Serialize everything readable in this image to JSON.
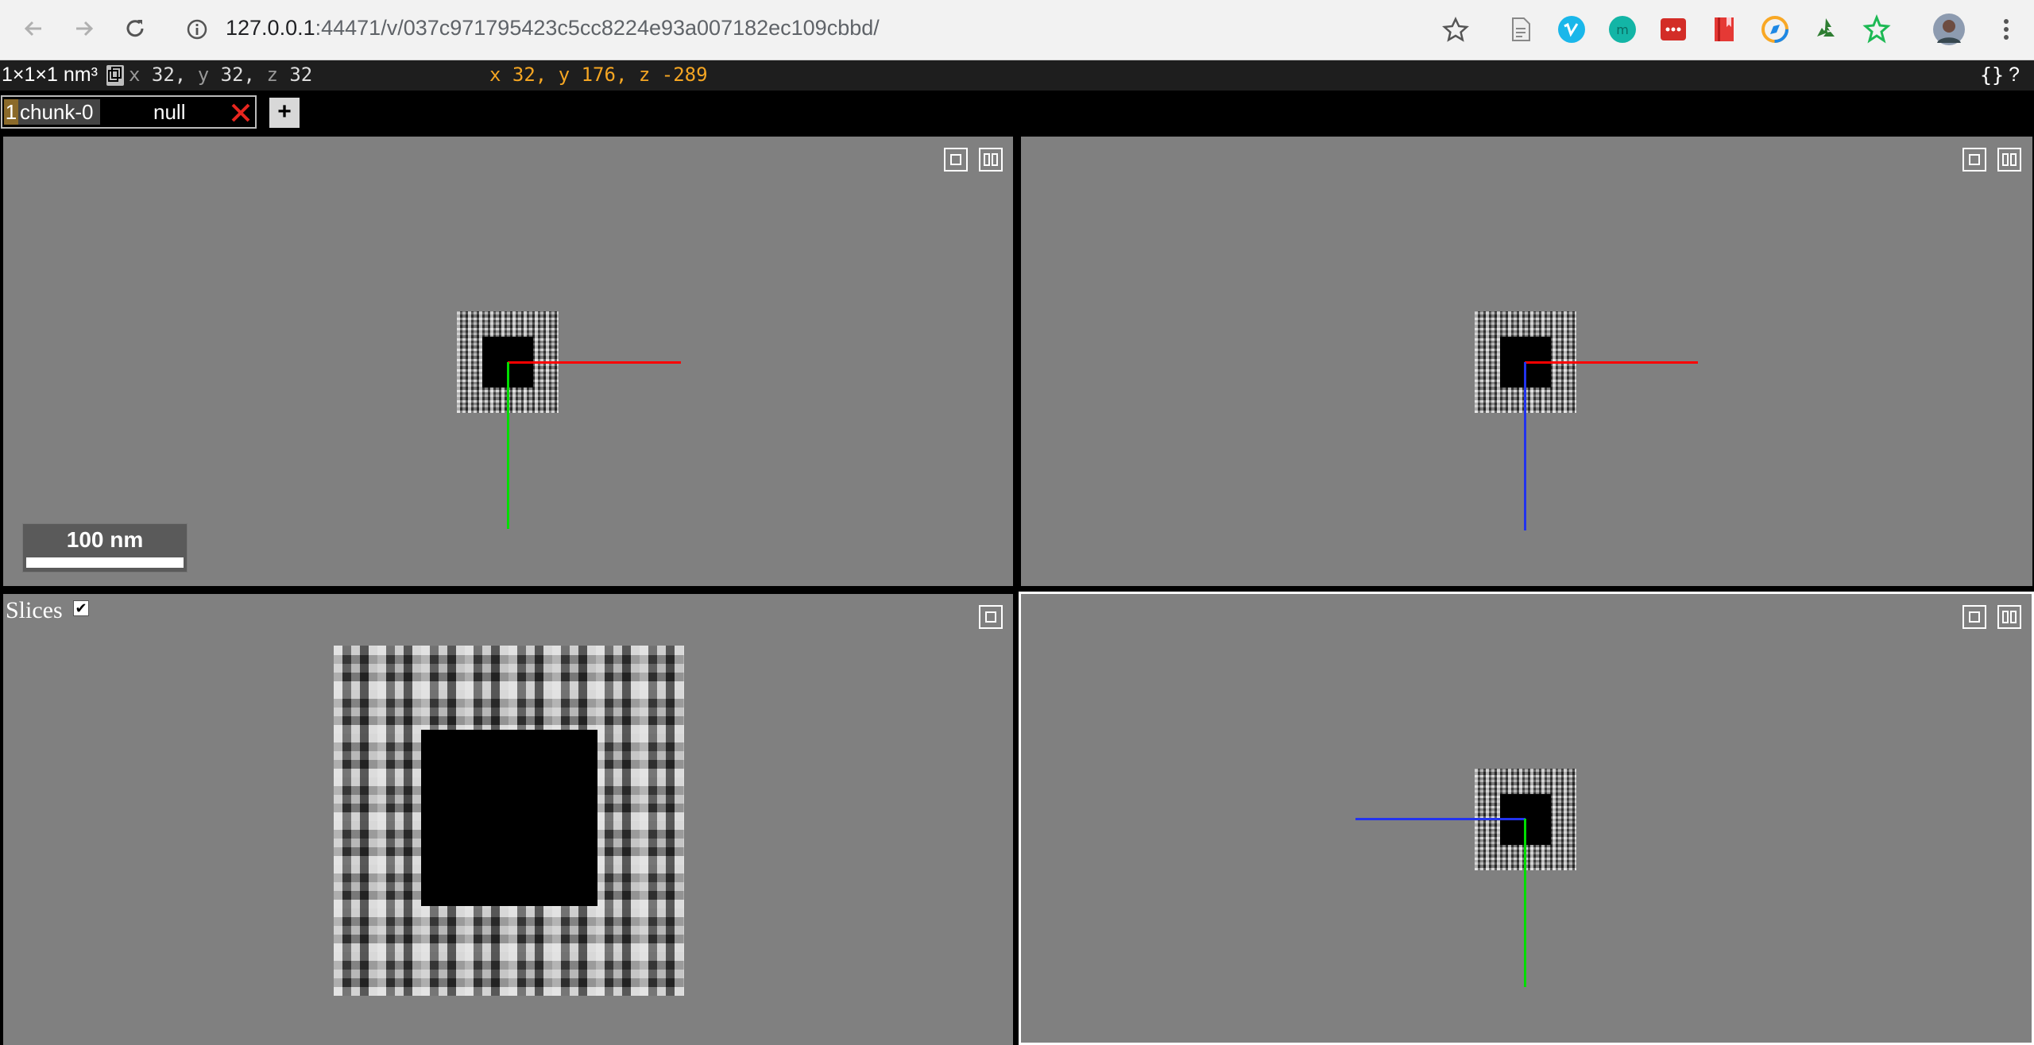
{
  "browser": {
    "url_host": "127.0.0.1",
    "url_rest": ":44471/v/037c971795423c5cc8224e93a007182ec109cbbd/",
    "extensions": [
      "document-icon",
      "vimeo-icon",
      "circle-m-icon",
      "lastpass-icon",
      "book-icon",
      "compass-icon",
      "recycle-icon",
      "star-gear-icon"
    ],
    "profile": "avatar"
  },
  "topbar": {
    "voxel_size": "1×1×1 nm³",
    "position": {
      "x_label": "x",
      "x": "32,",
      "y_label": "y",
      "y": "32,",
      "z_label": "z",
      "z": "32"
    },
    "mouse_position": "x 32, y 176, z -289",
    "json_label": "{}",
    "help_label": "?"
  },
  "layers": [
    {
      "index": "1",
      "name": "chunk-0",
      "value": "null"
    }
  ],
  "add_layer_label": "+",
  "panels": {
    "scalebar_label": "100 nm",
    "slices_label": "Slices",
    "slices_checked": true
  },
  "colors": {
    "axis_x": "#ff0000",
    "axis_y": "#00dd00",
    "axis_z": "#2233ee",
    "panel_bg": "#808080",
    "mouse_text": "#f5a623"
  }
}
